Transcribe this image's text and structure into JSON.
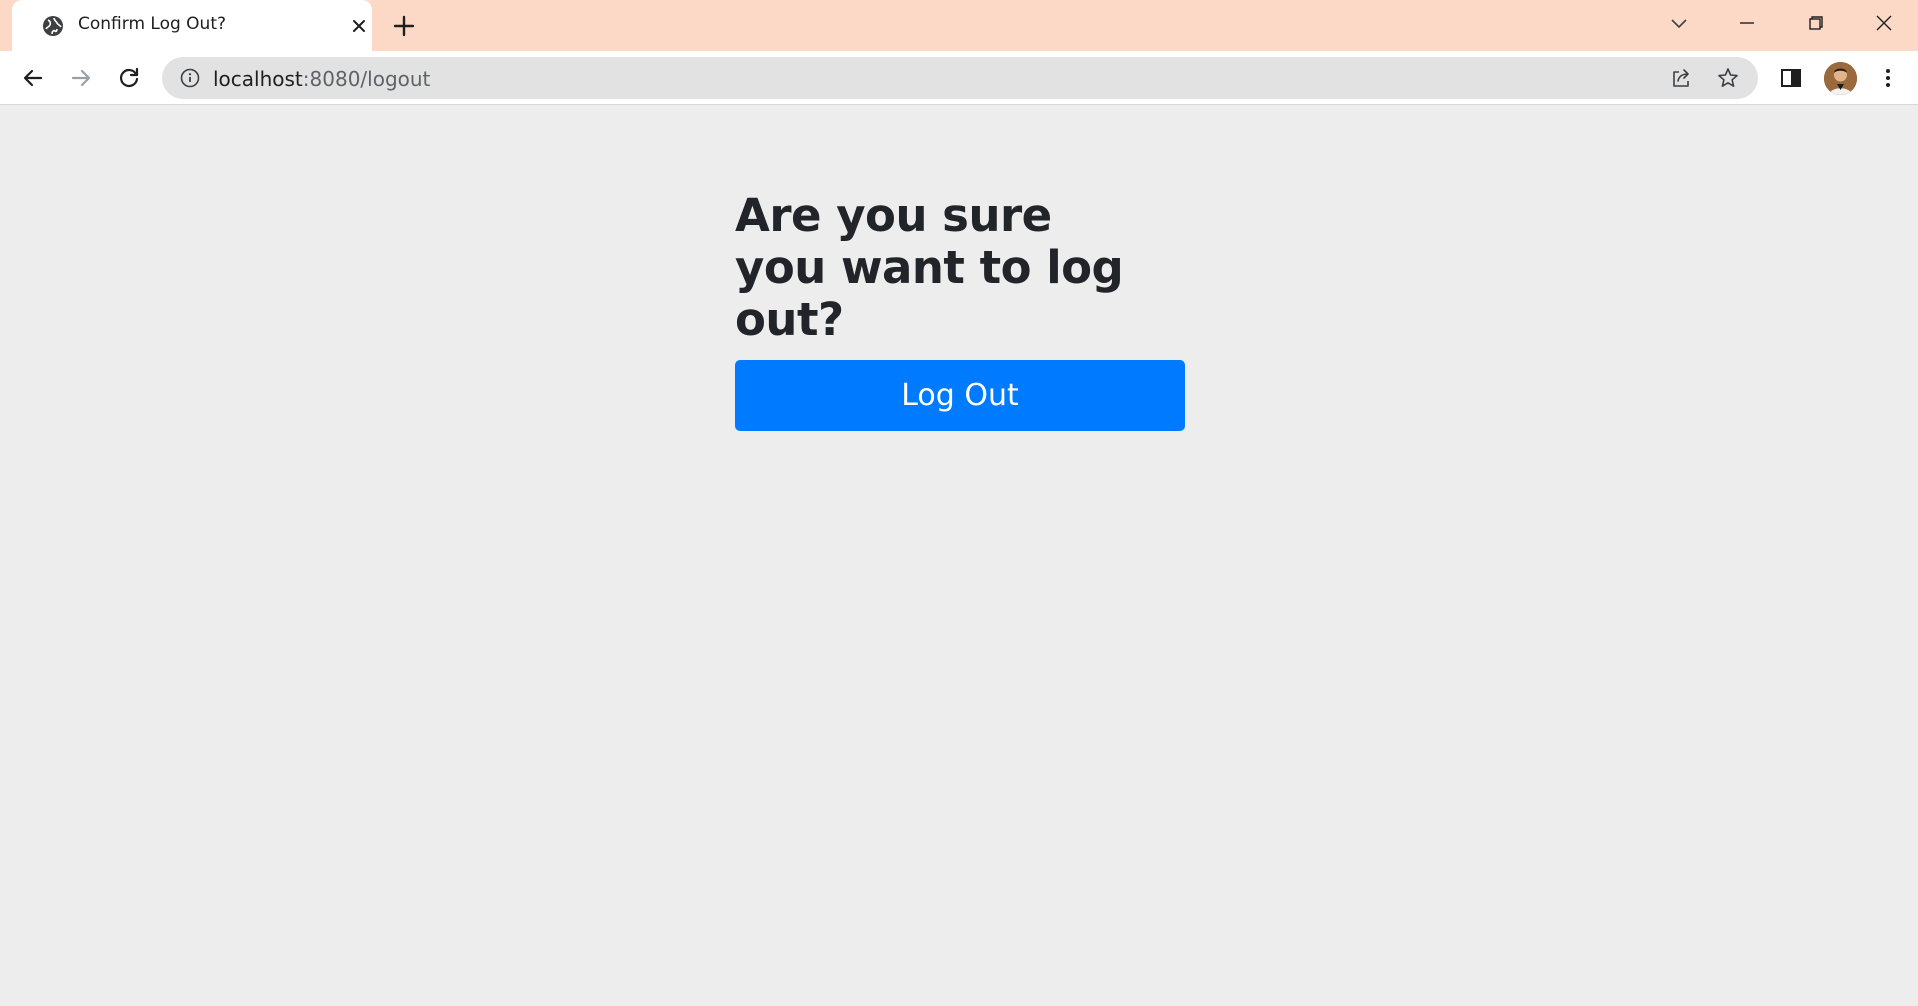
{
  "browser": {
    "tab": {
      "title": "Confirm Log Out?",
      "favicon": "globe-icon"
    },
    "address_bar": {
      "host": "localhost",
      "path": ":8080/logout"
    },
    "colors": {
      "tabstrip_bg": "#fcd9c6",
      "toolbar_bg": "#ffffff",
      "omnibox_bg": "#e2e2e2"
    }
  },
  "page": {
    "heading": "Are you sure you want to log out?",
    "button_label": "Log Out",
    "colors": {
      "background": "#ededed",
      "heading": "#212529",
      "button_bg": "#007bff",
      "button_text": "#ffffff"
    }
  }
}
